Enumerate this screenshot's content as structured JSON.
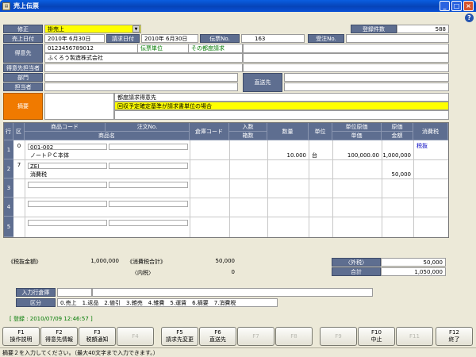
{
  "window": {
    "title": "売上伝票"
  },
  "mode": {
    "label": "修正",
    "value": "掛売上"
  },
  "reg_count": {
    "label": "登録件数",
    "value": "588"
  },
  "header": {
    "sales_date_label": "売上日付",
    "sales_date": "2010年 6月30日",
    "bill_date_label": "請求日付",
    "bill_date": "2010年 6月30日",
    "slip_no_label": "伝票No.",
    "slip_no": "163",
    "order_no_label": "受注No.",
    "order_no": ""
  },
  "customer": {
    "label": "得意先",
    "code": "0123456789012",
    "name": "ふくろう製造株式会社",
    "unit": "伝票単位",
    "billing": "その都度請求",
    "person_label": "得意先担当者",
    "dept_label": "部門",
    "staff_label": "担当者",
    "direct_label": "直送先"
  },
  "memo": {
    "label": "摘要",
    "line1": "都度請求得意先",
    "line2": "回収予定確定基準が請求書単位の場合"
  },
  "grid": {
    "headers": {
      "row": "行",
      "kubun": "区",
      "code": "商品コード",
      "order_no": "注文No.",
      "name": "商品名",
      "warehouse": "倉庫コード",
      "qty_in": "入数",
      "boxes": "箱数",
      "qty": "数量",
      "unit": "単位",
      "unit_cost": "単位原価",
      "unit_price": "単価",
      "cost": "原価",
      "amount": "金額",
      "tax": "消費税"
    },
    "rows": [
      {
        "no": "1",
        "kubun": "0",
        "code": "001-002",
        "name": "ノートＰＣ本体",
        "qty": "10.000",
        "unit": "台",
        "unit_price": "100,000.00",
        "amount": "1,000,000",
        "tax": "税抜"
      },
      {
        "no": "2",
        "kubun": "7",
        "code": "ZEI",
        "name": "消費税",
        "qty": "",
        "unit": "",
        "unit_price": "",
        "amount": "50,000",
        "tax": ""
      },
      {
        "no": "3",
        "kubun": "",
        "code": "",
        "name": "",
        "qty": "",
        "unit": "",
        "unit_price": "",
        "amount": "",
        "tax": ""
      },
      {
        "no": "4",
        "kubun": "",
        "code": "",
        "name": "",
        "qty": "",
        "unit": "",
        "unit_price": "",
        "amount": "",
        "tax": ""
      },
      {
        "no": "5",
        "kubun": "",
        "code": "",
        "name": "",
        "qty": "",
        "unit": "",
        "unit_price": "",
        "amount": "",
        "tax": ""
      }
    ]
  },
  "totals": {
    "pretax_label": "《税抜金額》",
    "pretax": "1,000,000",
    "tax_total_label": "《消費税合計》",
    "tax_total": "50,000",
    "inner_tax_label": "〈内税〉",
    "inner_tax": "0",
    "outer_tax_label": "〈外税〉",
    "outer_tax": "50,000",
    "total_label": "合計",
    "total": "1,050,000"
  },
  "input_warehouse": {
    "label": "入力行倉庫",
    "value": ""
  },
  "kubun_legend": {
    "label": "区分",
    "text": "0.売上　1.返品　2.値引　3.雑売　4.雑費　5.運賃　6.摘要　7.消費税"
  },
  "registered": {
    "text": "[ 登録 :  2010/07/09 12:46:57 ]"
  },
  "fkeys": [
    {
      "key": "F1",
      "label": "操作説明",
      "enabled": true
    },
    {
      "key": "F2",
      "label": "得意先情報",
      "enabled": true
    },
    {
      "key": "F3",
      "label": "税額通知",
      "enabled": true
    },
    {
      "key": "F4",
      "label": "",
      "enabled": false
    },
    {
      "key": "F5",
      "label": "請求先変更",
      "enabled": true
    },
    {
      "key": "F6",
      "label": "直送先",
      "enabled": true
    },
    {
      "key": "F7",
      "label": "",
      "enabled": false
    },
    {
      "key": "F8",
      "label": "",
      "enabled": false
    },
    {
      "key": "F9",
      "label": "",
      "enabled": false
    },
    {
      "key": "F10",
      "label": "中止",
      "enabled": true
    },
    {
      "key": "F11",
      "label": "",
      "enabled": false
    },
    {
      "key": "F12",
      "label": "終了",
      "enabled": true
    }
  ],
  "status": {
    "text": "摘要２を入力してください。（最大40文字まで入力できます。）"
  }
}
